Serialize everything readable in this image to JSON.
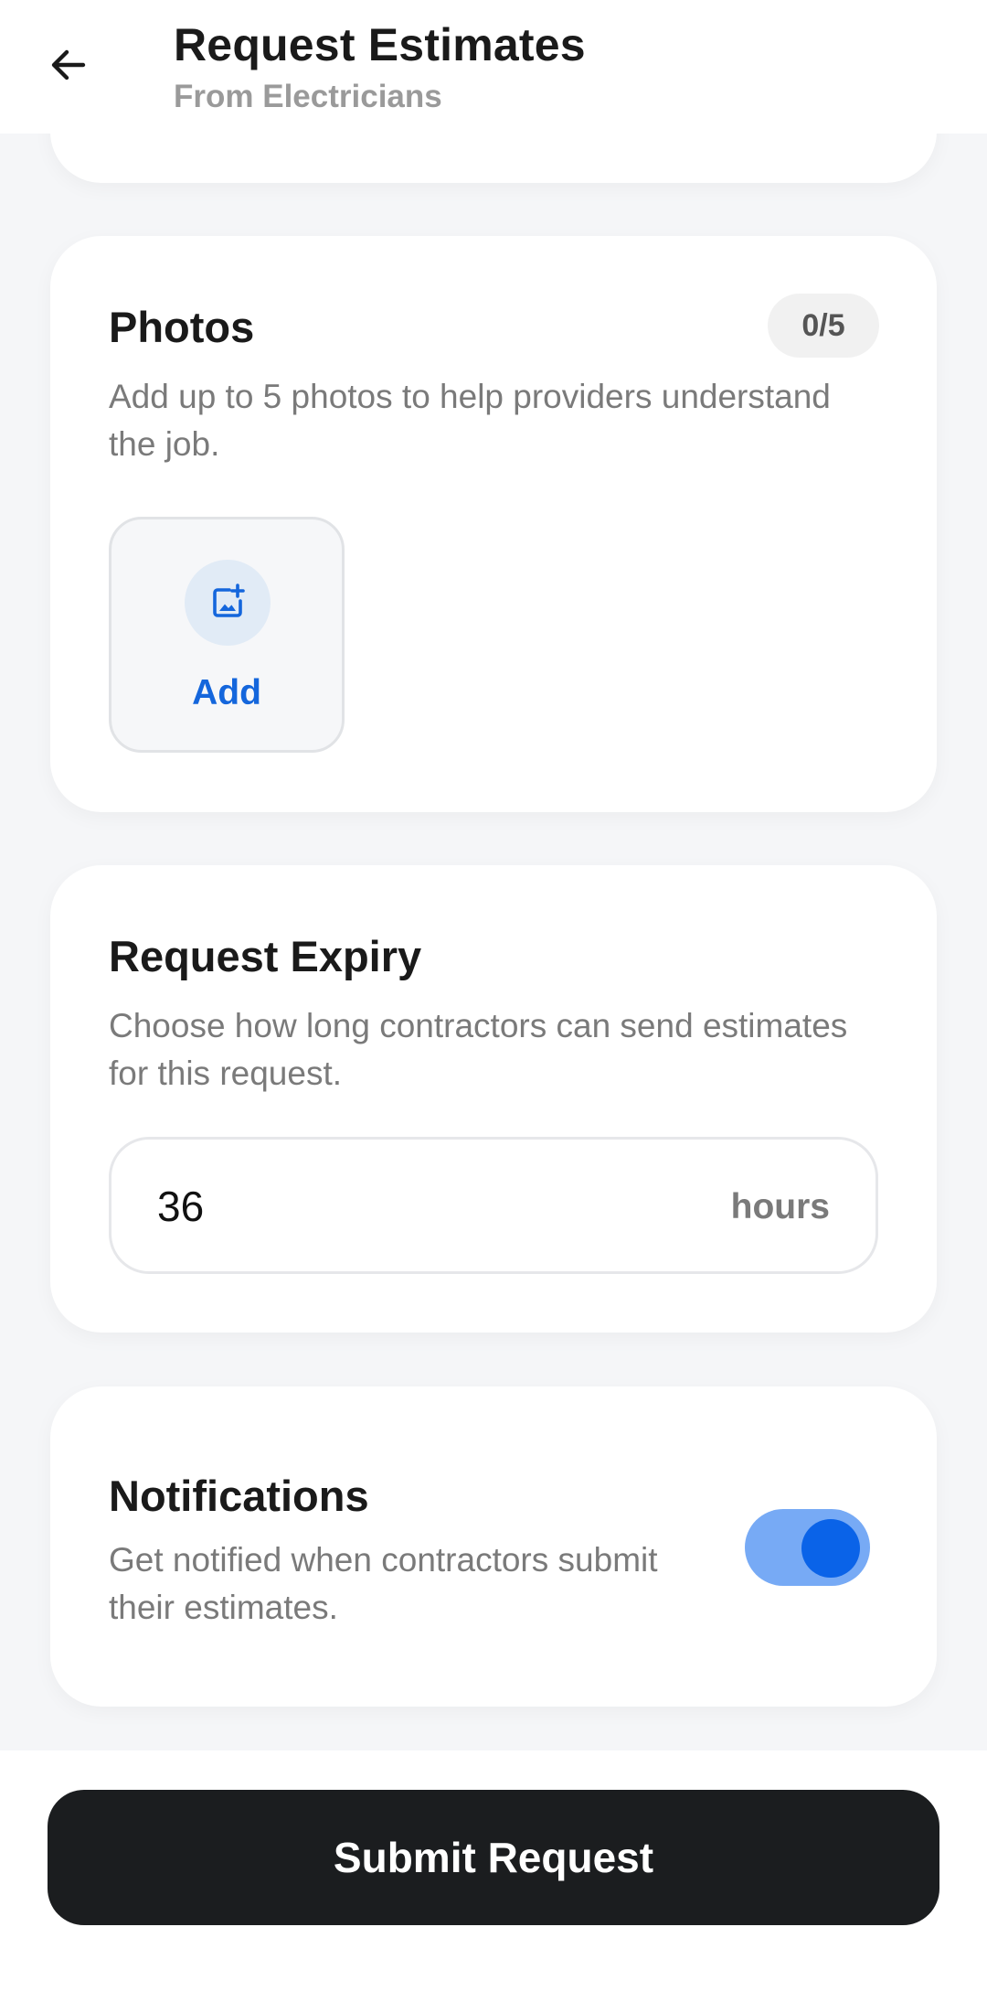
{
  "header": {
    "title": "Request Estimates",
    "subtitle": "From Electricians",
    "back_icon": "arrow-left-icon"
  },
  "photos": {
    "title": "Photos",
    "count_badge": "0/5",
    "description": "Add up to 5 photos to help providers understand the job.",
    "add_label": "Add",
    "add_icon": "add-photo-icon"
  },
  "expiry": {
    "title": "Request Expiry",
    "description": "Choose how long contractors can send estimates for this request.",
    "value": "36",
    "unit": "hours"
  },
  "notifications": {
    "title": "Notifications",
    "description": "Get notified when contractors submit their estimates.",
    "enabled": true
  },
  "footer": {
    "submit_label": "Submit Request"
  },
  "colors": {
    "accent": "#0a63e8",
    "button_dark": "#1b1d1f",
    "toggle_track": "#77aaf5"
  }
}
